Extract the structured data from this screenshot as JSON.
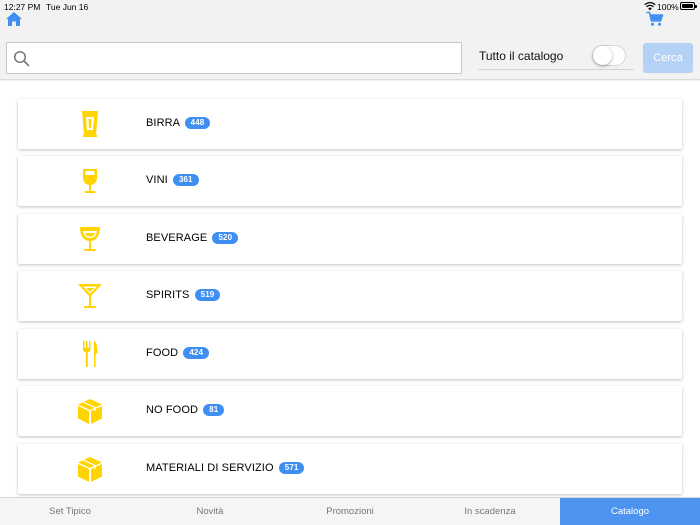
{
  "status_bar": {
    "time": "12:27 PM",
    "date": "Tue Jun 16",
    "battery": "100%"
  },
  "header": {
    "home_icon": "home-icon",
    "cart_icon": "cart-icon"
  },
  "search": {
    "value": "",
    "placeholder": "",
    "catalog_toggle_label": "Tutto il catalogo",
    "catalog_toggle_on": false,
    "search_button_label": "Cerca"
  },
  "categories": [
    {
      "label": "BIRRA",
      "count": "448",
      "icon": "beer-glass-icon"
    },
    {
      "label": "VINI",
      "count": "361",
      "icon": "wine-glass-icon"
    },
    {
      "label": "BEVERAGE",
      "count": "520",
      "icon": "goblet-icon"
    },
    {
      "label": "SPIRITS",
      "count": "519",
      "icon": "cocktail-icon"
    },
    {
      "label": "FOOD",
      "count": "424",
      "icon": "fork-knife-icon"
    },
    {
      "label": "NO FOOD",
      "count": "81",
      "icon": "box-icon"
    },
    {
      "label": "MATERIALI DI SERVIZIO",
      "count": "571",
      "icon": "box-icon"
    }
  ],
  "tabs": [
    {
      "label": "Set Tipico",
      "active": false
    },
    {
      "label": "Novità",
      "active": false
    },
    {
      "label": "Promozioni",
      "active": false
    },
    {
      "label": "In scadenza",
      "active": false
    },
    {
      "label": "Catalogo",
      "active": true
    }
  ],
  "colors": {
    "accent": "#4d94f1",
    "icon_yellow": "#ffd400",
    "badge": "#3f8ff2",
    "button_disabled": "#b4d2f6"
  }
}
